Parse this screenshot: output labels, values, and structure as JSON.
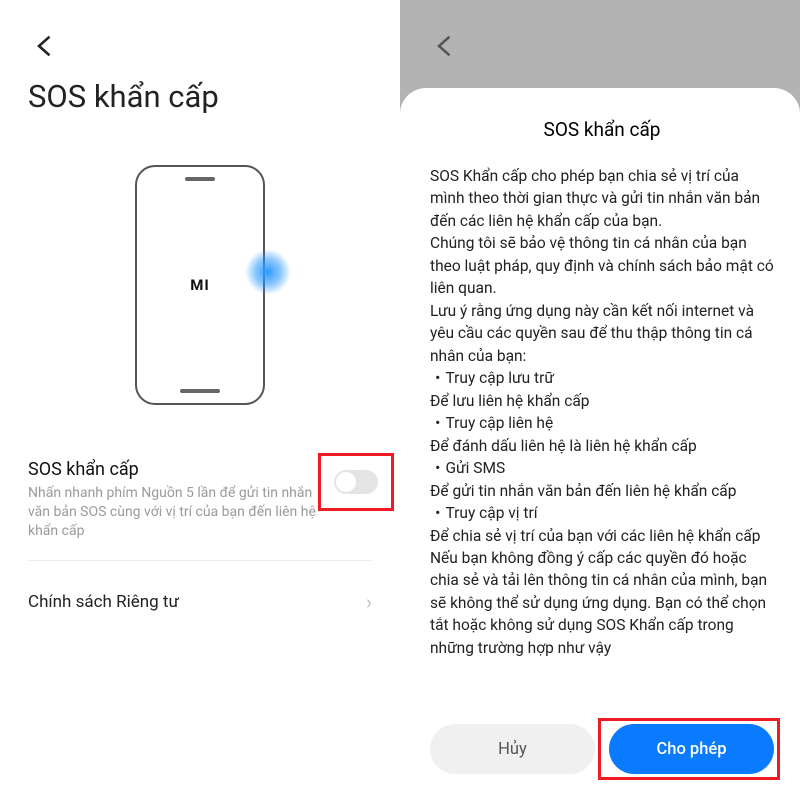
{
  "left": {
    "title": "SOS khẩn cấp",
    "phone_brand": "MI",
    "sos_label": "SOS khẩn cấp",
    "sos_desc": "Nhấn nhanh phím Nguồn 5 lần để gửi tin nhắn văn bản SOS cùng với vị trí của bạn đến liên hệ khẩn cấp",
    "privacy_label": "Chính sách Riêng tư"
  },
  "right": {
    "sheet_title": "SOS khẩn cấp",
    "body": "SOS Khẩn cấp cho phép bạn chia sẻ vị trí của mình theo thời gian thực và gửi tin nhắn văn bản đến các liên hệ khẩn cấp của bạn.\nChúng tôi sẽ bảo vệ thông tin cá nhân của bạn theo luật pháp, quy định và chính sách bảo mật có liên quan.\nLưu ý rằng ứng dụng này cần kết nối internet và yêu cầu các quyền sau để thu thập thông tin cá nhân của bạn:\n・Truy cập lưu trữ\nĐể lưu liên hệ khẩn cấp\n・Truy cập liên hệ\nĐể đánh dấu liên hệ là liên hệ khẩn cấp\n・Gửi SMS\nĐể gửi tin nhắn văn bản đến liên hệ khẩn cấp\n・Truy cập vị trí\nĐể chia sẻ vị trí của bạn với các liên hệ khẩn cấp\nNếu bạn không đồng ý cấp các quyền đó hoặc chia sẻ và tải lên thông tin cá nhân của mình, bạn sẽ không thể sử dụng ứng dụng. Bạn có thể chọn tắt hoặc không sử dụng SOS Khẩn cấp trong những trường hợp như vậy",
    "cancel": "Hủy",
    "allow": "Cho phép"
  }
}
